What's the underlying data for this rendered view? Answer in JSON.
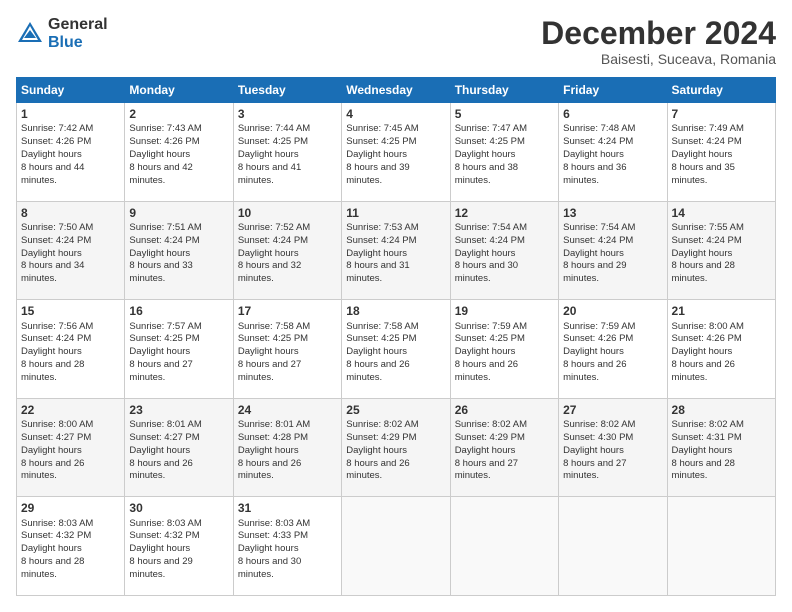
{
  "logo": {
    "line1": "General",
    "line2": "Blue"
  },
  "header": {
    "month": "December 2024",
    "location": "Baisesti, Suceava, Romania"
  },
  "weekdays": [
    "Sunday",
    "Monday",
    "Tuesday",
    "Wednesday",
    "Thursday",
    "Friday",
    "Saturday"
  ],
  "weeks": [
    [
      {
        "day": "1",
        "sunrise": "7:42 AM",
        "sunset": "4:26 PM",
        "daylight": "8 hours and 44 minutes."
      },
      {
        "day": "2",
        "sunrise": "7:43 AM",
        "sunset": "4:26 PM",
        "daylight": "8 hours and 42 minutes."
      },
      {
        "day": "3",
        "sunrise": "7:44 AM",
        "sunset": "4:25 PM",
        "daylight": "8 hours and 41 minutes."
      },
      {
        "day": "4",
        "sunrise": "7:45 AM",
        "sunset": "4:25 PM",
        "daylight": "8 hours and 39 minutes."
      },
      {
        "day": "5",
        "sunrise": "7:47 AM",
        "sunset": "4:25 PM",
        "daylight": "8 hours and 38 minutes."
      },
      {
        "day": "6",
        "sunrise": "7:48 AM",
        "sunset": "4:24 PM",
        "daylight": "8 hours and 36 minutes."
      },
      {
        "day": "7",
        "sunrise": "7:49 AM",
        "sunset": "4:24 PM",
        "daylight": "8 hours and 35 minutes."
      }
    ],
    [
      {
        "day": "8",
        "sunrise": "7:50 AM",
        "sunset": "4:24 PM",
        "daylight": "8 hours and 34 minutes."
      },
      {
        "day": "9",
        "sunrise": "7:51 AM",
        "sunset": "4:24 PM",
        "daylight": "8 hours and 33 minutes."
      },
      {
        "day": "10",
        "sunrise": "7:52 AM",
        "sunset": "4:24 PM",
        "daylight": "8 hours and 32 minutes."
      },
      {
        "day": "11",
        "sunrise": "7:53 AM",
        "sunset": "4:24 PM",
        "daylight": "8 hours and 31 minutes."
      },
      {
        "day": "12",
        "sunrise": "7:54 AM",
        "sunset": "4:24 PM",
        "daylight": "8 hours and 30 minutes."
      },
      {
        "day": "13",
        "sunrise": "7:54 AM",
        "sunset": "4:24 PM",
        "daylight": "8 hours and 29 minutes."
      },
      {
        "day": "14",
        "sunrise": "7:55 AM",
        "sunset": "4:24 PM",
        "daylight": "8 hours and 28 minutes."
      }
    ],
    [
      {
        "day": "15",
        "sunrise": "7:56 AM",
        "sunset": "4:24 PM",
        "daylight": "8 hours and 28 minutes."
      },
      {
        "day": "16",
        "sunrise": "7:57 AM",
        "sunset": "4:25 PM",
        "daylight": "8 hours and 27 minutes."
      },
      {
        "day": "17",
        "sunrise": "7:58 AM",
        "sunset": "4:25 PM",
        "daylight": "8 hours and 27 minutes."
      },
      {
        "day": "18",
        "sunrise": "7:58 AM",
        "sunset": "4:25 PM",
        "daylight": "8 hours and 26 minutes."
      },
      {
        "day": "19",
        "sunrise": "7:59 AM",
        "sunset": "4:25 PM",
        "daylight": "8 hours and 26 minutes."
      },
      {
        "day": "20",
        "sunrise": "7:59 AM",
        "sunset": "4:26 PM",
        "daylight": "8 hours and 26 minutes."
      },
      {
        "day": "21",
        "sunrise": "8:00 AM",
        "sunset": "4:26 PM",
        "daylight": "8 hours and 26 minutes."
      }
    ],
    [
      {
        "day": "22",
        "sunrise": "8:00 AM",
        "sunset": "4:27 PM",
        "daylight": "8 hours and 26 minutes."
      },
      {
        "day": "23",
        "sunrise": "8:01 AM",
        "sunset": "4:27 PM",
        "daylight": "8 hours and 26 minutes."
      },
      {
        "day": "24",
        "sunrise": "8:01 AM",
        "sunset": "4:28 PM",
        "daylight": "8 hours and 26 minutes."
      },
      {
        "day": "25",
        "sunrise": "8:02 AM",
        "sunset": "4:29 PM",
        "daylight": "8 hours and 26 minutes."
      },
      {
        "day": "26",
        "sunrise": "8:02 AM",
        "sunset": "4:29 PM",
        "daylight": "8 hours and 27 minutes."
      },
      {
        "day": "27",
        "sunrise": "8:02 AM",
        "sunset": "4:30 PM",
        "daylight": "8 hours and 27 minutes."
      },
      {
        "day": "28",
        "sunrise": "8:02 AM",
        "sunset": "4:31 PM",
        "daylight": "8 hours and 28 minutes."
      }
    ],
    [
      {
        "day": "29",
        "sunrise": "8:03 AM",
        "sunset": "4:32 PM",
        "daylight": "8 hours and 28 minutes."
      },
      {
        "day": "30",
        "sunrise": "8:03 AM",
        "sunset": "4:32 PM",
        "daylight": "8 hours and 29 minutes."
      },
      {
        "day": "31",
        "sunrise": "8:03 AM",
        "sunset": "4:33 PM",
        "daylight": "8 hours and 30 minutes."
      },
      null,
      null,
      null,
      null
    ]
  ]
}
